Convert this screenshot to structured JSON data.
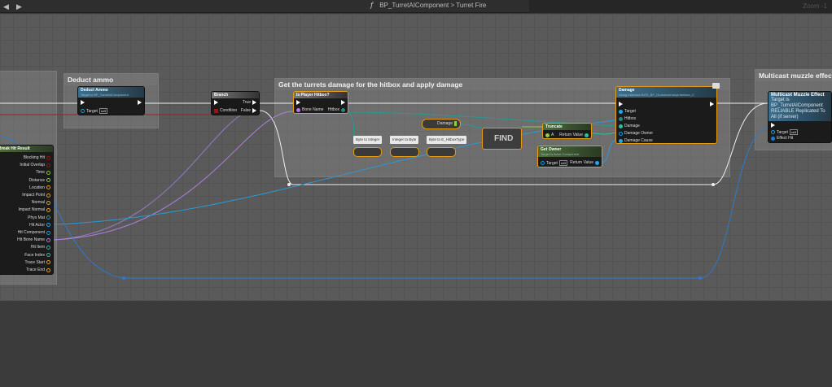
{
  "topbar": {
    "back": "◀",
    "forward": "▶",
    "function_glyph": "f",
    "blueprint": "BP_TurretAIComponent",
    "separator": ">",
    "graph": "Turret Fire",
    "zoom": "Zoom -1"
  },
  "comments": {
    "deduct": "Deduct ammo",
    "apply": "Get the turrets damage for the hitbox and apply damage",
    "multicast": "Multicast muzzle effect"
  },
  "break_hit": {
    "title": "Break Hit Result",
    "pins": [
      "Blocking Hit",
      "Initial Overlap",
      "Time",
      "Distance",
      "Location",
      "Impact Point",
      "Normal",
      "Impact Normal",
      "Phys Mat",
      "Hit Actor",
      "Hit Component",
      "Hit Bone Name",
      "Hit Item",
      "Face Index",
      "Trace Start",
      "Trace End"
    ],
    "colors": [
      "#a01010",
      "#a01010",
      "#7ecf2a",
      "#7ecf2a",
      "#e5a020",
      "#e5a020",
      "#e5a020",
      "#e5a020",
      "#1e9ad8",
      "#1ea8f0",
      "#1e9ad8",
      "#c070f0",
      "#1ec0a0",
      "#1ec0a0",
      "#e5a020",
      "#e5a020"
    ]
  },
  "deduct_ammo": {
    "title": "Deduct Ammo",
    "subtitle": "Target is BP_TurretAIComponent",
    "target": "Target",
    "self": "self"
  },
  "branch": {
    "title": "Branch",
    "condition": "Condition",
    "true": "True",
    "false": "False"
  },
  "is_player_hitbox": {
    "title": "Is Player Hitbox?",
    "bone_name": "Bone Name",
    "hitbox": "Hitbox"
  },
  "damage_var": {
    "label": "Damage"
  },
  "conversions": [
    "Byte to Integer",
    "Integer to Byte",
    "Byte to E_HitboxType"
  ],
  "find": {
    "label": "FIND"
  },
  "truncate": {
    "title": "Truncate",
    "a": "A",
    "ret": "Return Value"
  },
  "get_owner": {
    "title": "Get Owner",
    "subtitle": "Target is Actor Component",
    "target": "Target",
    "self": "self",
    "ret": "Return Value"
  },
  "damage_msg": {
    "title": "Damage",
    "subtitle": "Using Interface BGS_BP_GunsInventoryInterface_C",
    "pins": [
      "Target",
      "Hitbox",
      "Damage",
      "Damage Owner",
      "Damage Cause"
    ]
  },
  "multicast": {
    "title": "Multicast Muzzle Effect",
    "subtitle": "Target is BP_TurretAIComponent",
    "subtitle2": "RELIABLE Replicated To All (if server)",
    "target": "Target",
    "self": "self",
    "effect": "Effect Hit"
  }
}
